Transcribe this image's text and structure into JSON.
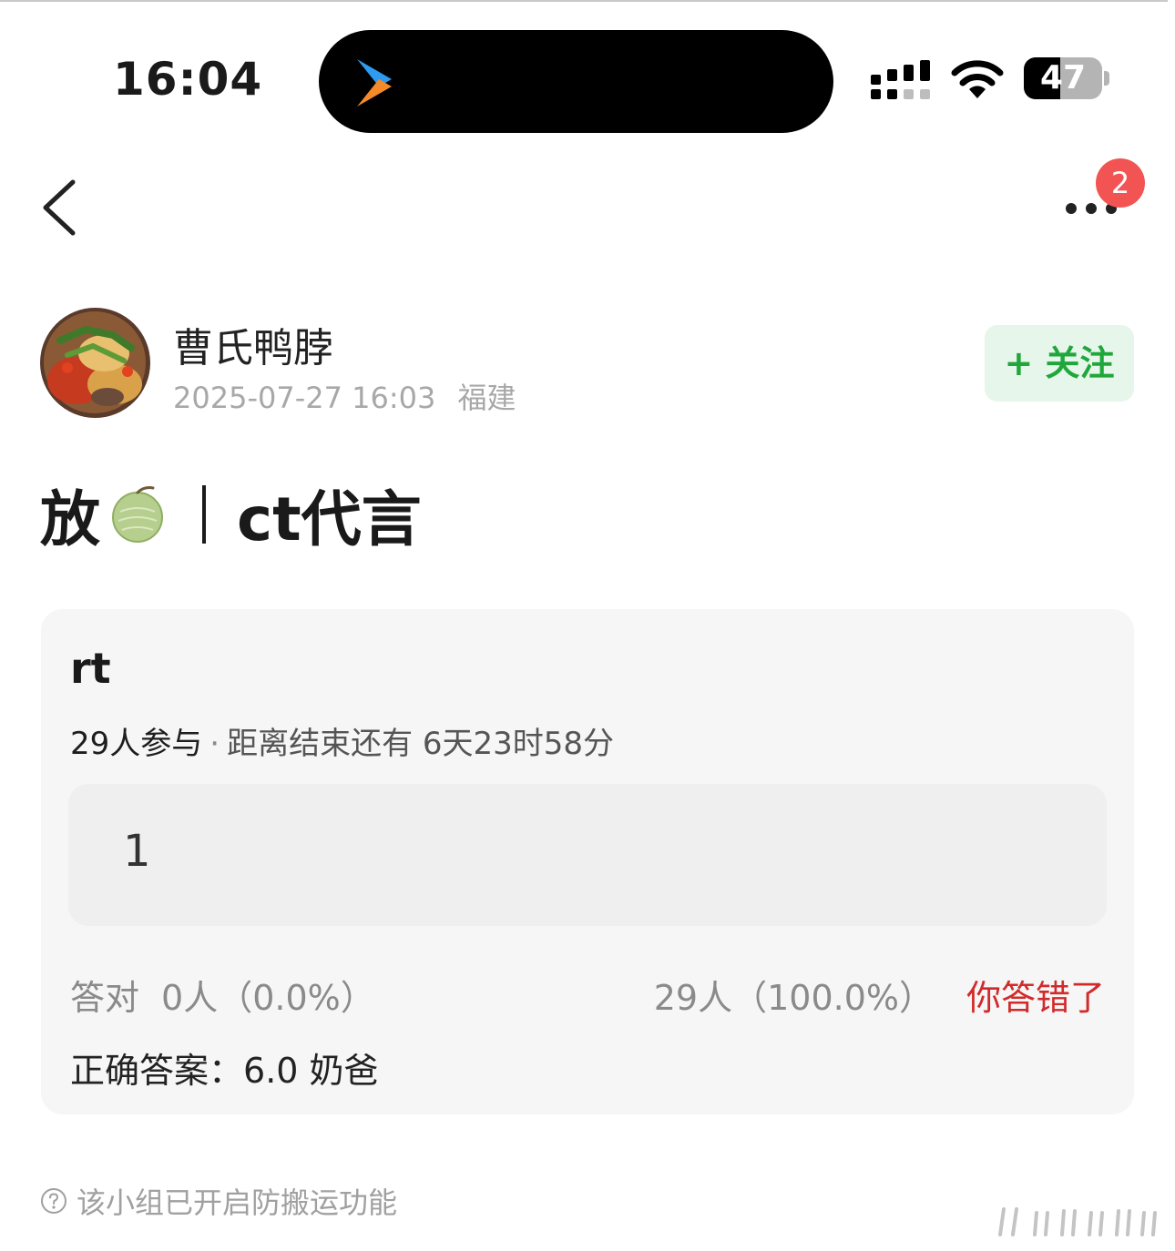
{
  "status_bar": {
    "time": "16:04",
    "battery_level": "47",
    "battery_fraction": 0.47,
    "island_icon": "video-app-logo-icon",
    "icons": [
      "cellular-signal-icon",
      "wifi-icon",
      "battery-icon"
    ]
  },
  "nav": {
    "back_icon": "back-chevron-icon",
    "more_icon": "more-dots-icon",
    "notification_count": "2"
  },
  "author": {
    "name": "曹氏鸭脖",
    "timestamp": "2025-07-27 16:03",
    "location": "福建",
    "follow_label": "+ 关注"
  },
  "post": {
    "title_prefix": "放",
    "title_emoji": "🍈",
    "title_suffix": "ct代言"
  },
  "quiz": {
    "question": "rt",
    "participants": "29人参与",
    "remaining": "距离结束还有 6天23时58分",
    "option_text": "1",
    "correct_label": "答对",
    "correct_stat": "0人（0.0%）",
    "wrong_stat": "29人（100.0%）",
    "wrong_label": "你答错了",
    "answer_label": "正确答案：",
    "answer_value": "6.0 奶爸"
  },
  "footer": {
    "note": "该小组已开启防搬运功能"
  },
  "colors": {
    "follow_green": "#20a73c",
    "wrong_red": "#d22a2a",
    "badge_red": "#f25454",
    "card_bg": "#f6f6f6"
  }
}
